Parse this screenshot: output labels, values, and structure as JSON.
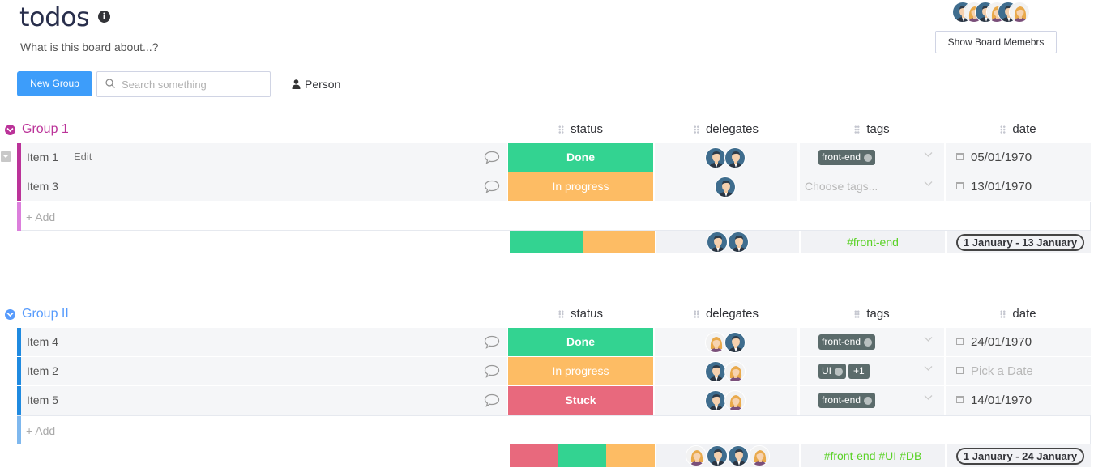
{
  "header": {
    "title": "todos",
    "subtitle": "What is this board about...?",
    "show_members_label": "Show Board Memebrs",
    "board_avatars": [
      "man",
      "woman",
      "man",
      "woman",
      "man",
      "woman"
    ]
  },
  "toolbar": {
    "new_group_label": "New Group",
    "search_placeholder": "Search something",
    "person_label": "Person"
  },
  "colors": {
    "group1": "#bb3354",
    "group2": "#579bfc",
    "done": "#33d391",
    "in_progress": "#fdbc64",
    "stuck": "#e8697d",
    "tag_summary": "#5ad226"
  },
  "groups": [
    {
      "title": "Group 1",
      "columns": [
        "status",
        "delegates",
        "tags",
        "date"
      ],
      "items": [
        {
          "name": "Item 1",
          "edit": "Edit",
          "status": "Done",
          "delegates": [
            "man",
            "man"
          ],
          "tags": [
            "front-end"
          ],
          "date": "05/01/1970"
        },
        {
          "name": "Item 3",
          "status": "In progress",
          "delegates": [
            "man"
          ],
          "tags_placeholder": "Choose tags...",
          "date": "13/01/1970"
        }
      ],
      "add_label": "+ Add",
      "summary": {
        "status_split": [
          "done",
          "in_progress"
        ],
        "delegates": [
          "man",
          "man"
        ],
        "tags": "#front-end",
        "date_range": "1 January - 13 January"
      }
    },
    {
      "title": "Group II",
      "columns": [
        "status",
        "delegates",
        "tags",
        "date"
      ],
      "items": [
        {
          "name": "Item 4",
          "status": "Done",
          "delegates": [
            "woman",
            "man"
          ],
          "tags": [
            "front-end"
          ],
          "date": "24/01/1970"
        },
        {
          "name": "Item 2",
          "status": "In progress",
          "delegates": [
            "man",
            "woman"
          ],
          "tags": [
            "UI"
          ],
          "tags_more": "+1",
          "date_placeholder": "Pick a Date"
        },
        {
          "name": "Item 5",
          "status": "Stuck",
          "delegates": [
            "man",
            "woman"
          ],
          "tags": [
            "front-end"
          ],
          "date": "14/01/1970"
        }
      ],
      "add_label": "+ Add",
      "summary": {
        "status_split": [
          "stuck",
          "done",
          "in_progress"
        ],
        "delegates": [
          "woman",
          "man",
          "man",
          "woman"
        ],
        "tags": "#front-end #UI #DB",
        "date_range": "1 January - 24 January"
      }
    }
  ]
}
